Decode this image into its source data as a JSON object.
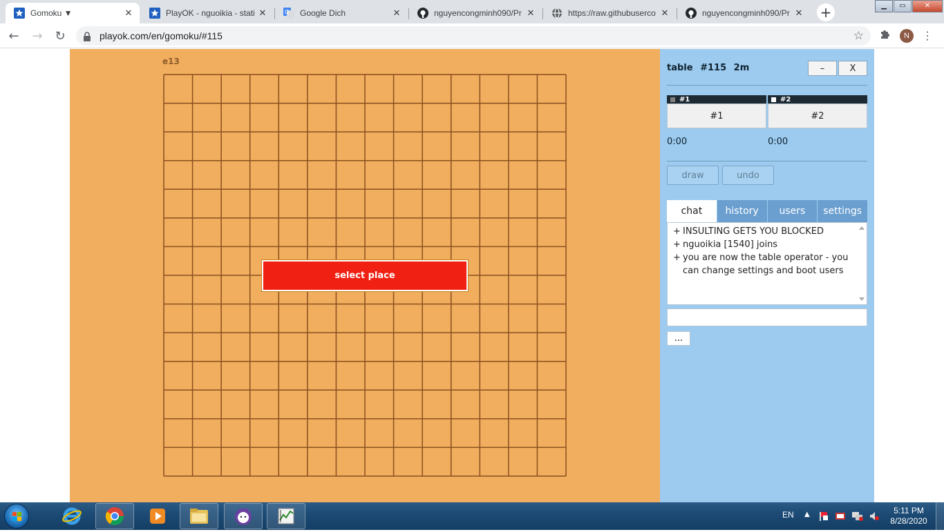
{
  "browser": {
    "tabs": [
      {
        "title": "Gomoku ▼",
        "icon": "star-icon",
        "active": true
      },
      {
        "title": "PlayOK - nguoikia - stati",
        "icon": "star-icon",
        "active": false
      },
      {
        "title": "Google Dich",
        "icon": "google-translate-icon",
        "active": false
      },
      {
        "title": "nguyencongminh090/Pr",
        "icon": "github-icon",
        "active": false
      },
      {
        "title": "https://raw.githubuserco",
        "icon": "globe-icon",
        "active": false
      },
      {
        "title": "nguyencongminh090/Pr",
        "icon": "github-icon",
        "active": false
      }
    ],
    "url": "playok.com/en/gomoku/#115",
    "profile_initial": "N"
  },
  "game": {
    "coord_label": "e13",
    "board_size": 14,
    "select_place_label": "select place"
  },
  "side": {
    "table_title": "table #115   2m",
    "minimize_label": "–",
    "close_label": "X",
    "players": [
      {
        "header": "#1",
        "name": "#1",
        "clock": "0:00",
        "color": "#808080"
      },
      {
        "header": "#2",
        "name": "#2",
        "clock": "0:00",
        "color": "#ffffff"
      }
    ],
    "draw_label": "draw",
    "undo_label": "undo",
    "tabs": [
      {
        "label": "chat",
        "active": true
      },
      {
        "label": "history",
        "active": false
      },
      {
        "label": "users",
        "active": false
      },
      {
        "label": "settings",
        "active": false
      }
    ],
    "chat": [
      {
        "prefix": "+",
        "text": "INSULTING GETS YOU BLOCKED"
      },
      {
        "prefix": "+",
        "text": "nguoikia [1540] joins"
      },
      {
        "prefix": "+",
        "text": "you are now the table operator - you can change settings and boot users"
      }
    ],
    "more_label": "..."
  },
  "taskbar": {
    "lang": "EN",
    "time": "5:11 PM",
    "date": "8/28/2020"
  }
}
